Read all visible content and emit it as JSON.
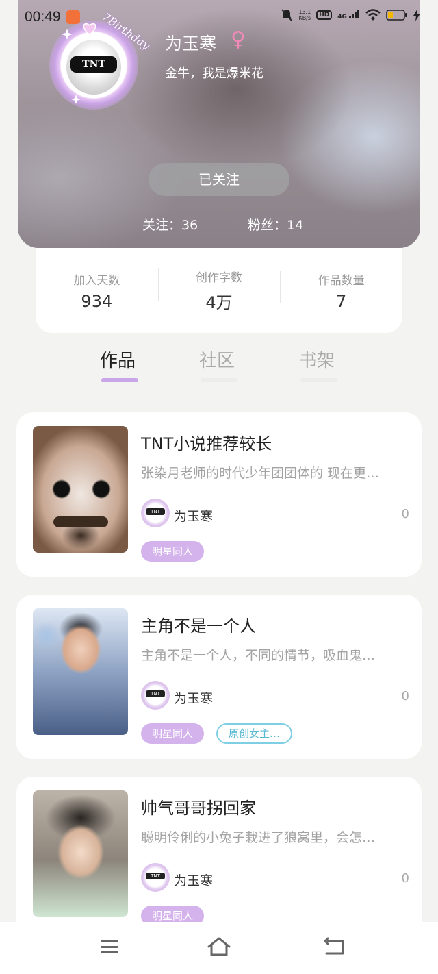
{
  "status_bar": {
    "time": "00:49",
    "net_speed_top": "13.1",
    "net_speed_bottom": "KB/s",
    "hd": "HD",
    "signal": "4G"
  },
  "profile": {
    "avatar_text": "TNT",
    "avatar_caption": "7Birthday",
    "name": "为玉寒",
    "gender_symbol": "♀",
    "bio": "金牛，我是爆米花",
    "follow_button": "已关注",
    "following": "关注：36",
    "followers": "粉丝：14"
  },
  "stats": [
    {
      "label": "加入天数",
      "value": "934"
    },
    {
      "label": "创作字数",
      "value": "4万"
    },
    {
      "label": "作品数量",
      "value": "7"
    }
  ],
  "tabs": [
    {
      "label": "作品",
      "active": true
    },
    {
      "label": "社区",
      "active": false
    },
    {
      "label": "书架",
      "active": false
    }
  ],
  "works": [
    {
      "title": "TNT小说推荐较长",
      "description": "张染月老师的时代少年团团体的 现在更…",
      "author": "为玉寒",
      "count": "0",
      "tags": [
        {
          "label": "明星同人",
          "style": "fill"
        }
      ]
    },
    {
      "title": "主角不是一个人",
      "description": "主角不是一个人，不同的情节，吸血鬼…",
      "author": "为玉寒",
      "count": "0",
      "tags": [
        {
          "label": "明星同人",
          "style": "fill"
        },
        {
          "label": "原创女主…",
          "style": "outline"
        }
      ]
    },
    {
      "title": "帅气哥哥拐回家",
      "description": "聪明伶俐的小兔子栽进了狼窝里，会怎…",
      "author": "为玉寒",
      "count": "0",
      "tags": [
        {
          "label": "明星同人",
          "style": "fill"
        }
      ]
    }
  ],
  "colors": {
    "accent": "#c9a6e8",
    "tag_fill": "#d4b3ec",
    "tag_outline": "#7fcfe4",
    "gender": "#f08ab8"
  }
}
